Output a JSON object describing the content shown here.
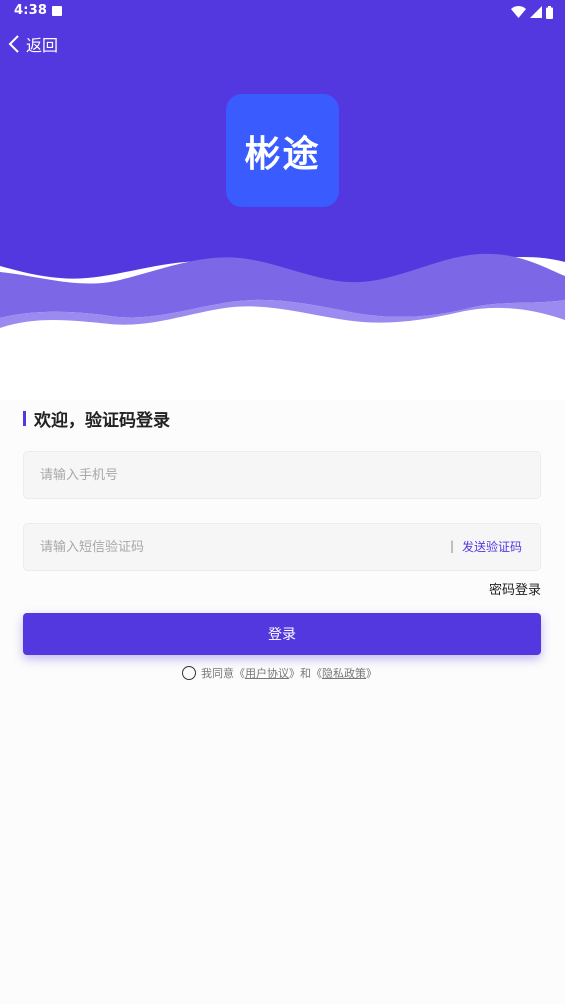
{
  "status_bar": {
    "time": "4:38"
  },
  "header": {
    "back_label": "返回"
  },
  "logo": {
    "text": "彬途"
  },
  "login": {
    "heading": "欢迎，验证码登录",
    "phone_placeholder": "请输入手机号",
    "code_placeholder": "请输入短信验证码",
    "code_divider": "|",
    "send_code_label": "发送验证码",
    "password_login_label": "密码登录",
    "submit_label": "登录"
  },
  "agreement": {
    "prefix": "我同意《",
    "user_agreement": "用户协议",
    "middle": "》和《",
    "privacy_policy": "隐私政策",
    "suffix": "》"
  },
  "colors": {
    "primary": "#5338e0",
    "logo_bg": "#3a5cff"
  }
}
